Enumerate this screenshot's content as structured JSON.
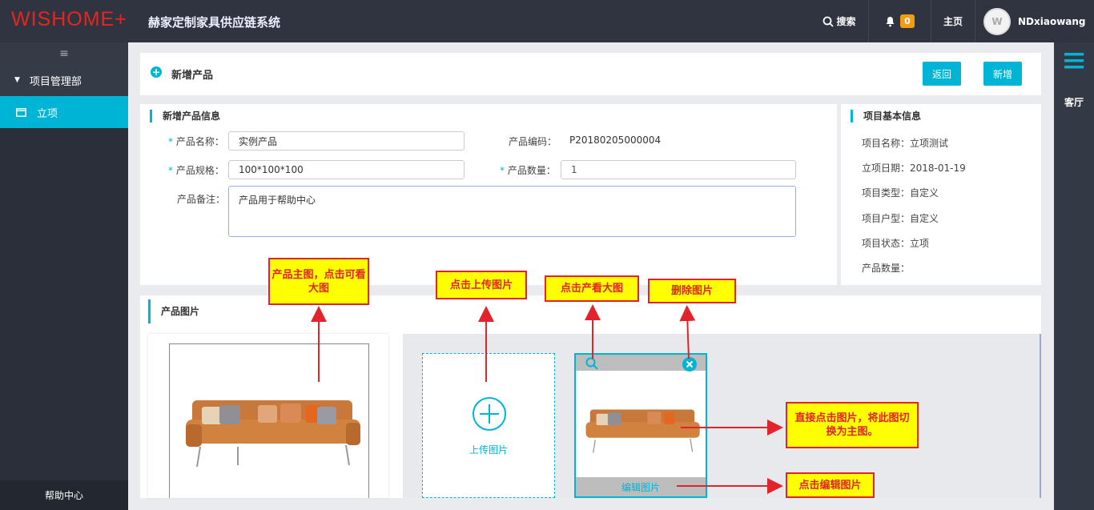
{
  "topbar": {
    "logo": "WISHOME+",
    "system_title": "赫家定制家具供应链系统",
    "search_label": "搜索",
    "notif_count": "0",
    "home_label": "主页",
    "user_name": "NDxiaowang",
    "avatar_text": "W"
  },
  "sidebar": {
    "toggle_icon": "≡",
    "group_label": "项目管理部",
    "active_item": "立项",
    "help": "帮助中心"
  },
  "rightbar": {
    "label": "客厅"
  },
  "header": {
    "title": "新增产品",
    "back_button": "返回",
    "add_button": "新增"
  },
  "product_info": {
    "section_title": "新增产品信息",
    "name_label": "产品名称：",
    "name_value": "实例产品",
    "code_label": "产品编码：",
    "code_value": "P20180205000004",
    "spec_label": "产品规格：",
    "spec_value": "100*100*100",
    "qty_label": "产品数量：",
    "qty_value": "1",
    "remark_label": "产品备注：",
    "remark_value": "产品用于帮助中心"
  },
  "project_info": {
    "section_title": "项目基本信息",
    "lines": [
      "项目名称：立项测试",
      "立项日期：2018-01-19",
      "项目类型：自定义",
      "项目户型：自定义",
      "项目状态：立项",
      "产品数量："
    ]
  },
  "images": {
    "section_title": "产品图片",
    "upload_label": "上传图片",
    "edit_label": "编辑图片"
  },
  "annotations": {
    "main_image": "产品主图，点击可看大图",
    "upload": "点击上传图片",
    "view": "点击产看大图",
    "delete": "删除图片",
    "switch": "直接点击图片，将此图切换为主图。",
    "edit": "点击编辑图片"
  },
  "colors": {
    "accent": "#00b4d5",
    "callout_bg": "#ffff00",
    "callout_fg": "#e3232b",
    "topbar": "#2f3440"
  }
}
